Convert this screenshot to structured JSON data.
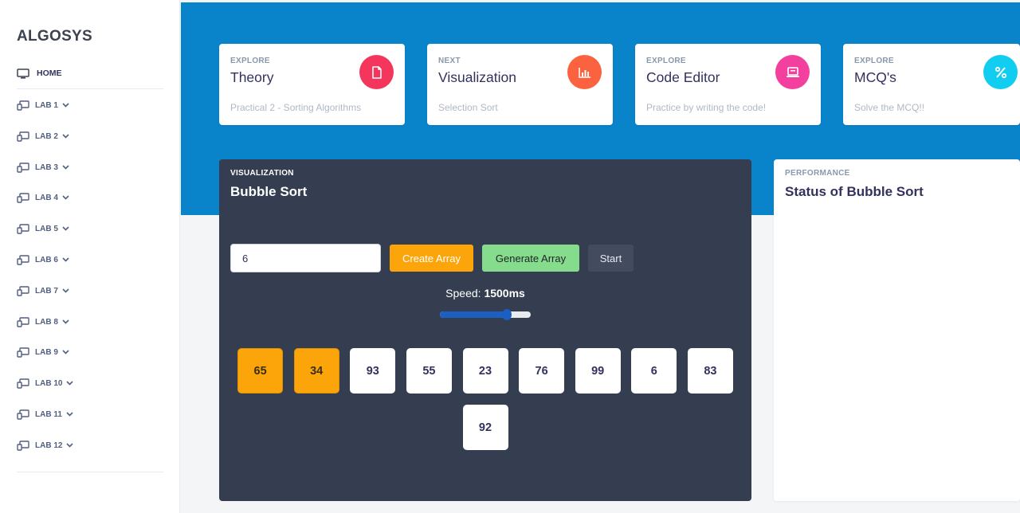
{
  "sidebar": {
    "brand": "ALGOSYS",
    "home_label": "HOME",
    "labs": [
      "LAB 1",
      "LAB 2",
      "LAB 3",
      "LAB 4",
      "LAB 5",
      "LAB 6",
      "LAB 7",
      "LAB 8",
      "LAB 9",
      "LAB 10",
      "LAB 11",
      "LAB 12"
    ]
  },
  "cards": [
    {
      "kicker": "EXPLORE",
      "title": "Theory",
      "subtitle": "Practical 2 - Sorting Algorithms",
      "icon": "document-icon",
      "color": "#f5365c"
    },
    {
      "kicker": "NEXT",
      "title": "Visualization",
      "subtitle": "Selection Sort",
      "icon": "chart-bar-icon",
      "color": "#fb6340"
    },
    {
      "kicker": "EXPLORE",
      "title": "Code Editor",
      "subtitle": "Practice by writing the code!",
      "icon": "laptop-icon",
      "color": "#f3409e"
    },
    {
      "kicker": "EXPLORE",
      "title": "MCQ's",
      "subtitle": "Solve the MCQ!!",
      "icon": "percent-icon",
      "color": "#11cdef"
    }
  ],
  "visualization": {
    "kicker": "VISUALIZATION",
    "title": "Bubble Sort",
    "size_input_value": "6",
    "create_label": "Create Array",
    "generate_label": "Generate Array",
    "start_label": "Start",
    "speed_prefix": "Speed: ",
    "speed_value": "1500ms",
    "speed_slider_fraction": 0.74,
    "array": [
      65,
      34,
      93,
      55,
      23,
      76,
      99,
      6,
      83,
      92
    ],
    "active_indices": [
      0,
      1
    ]
  },
  "performance": {
    "kicker": "PERFORMANCE",
    "title": "Status of Bubble Sort"
  },
  "colors": {
    "header_band": "#0984cb",
    "panel_dark": "#343e50",
    "active_bar": "#fba50a",
    "generate_button": "#86dc8d"
  }
}
